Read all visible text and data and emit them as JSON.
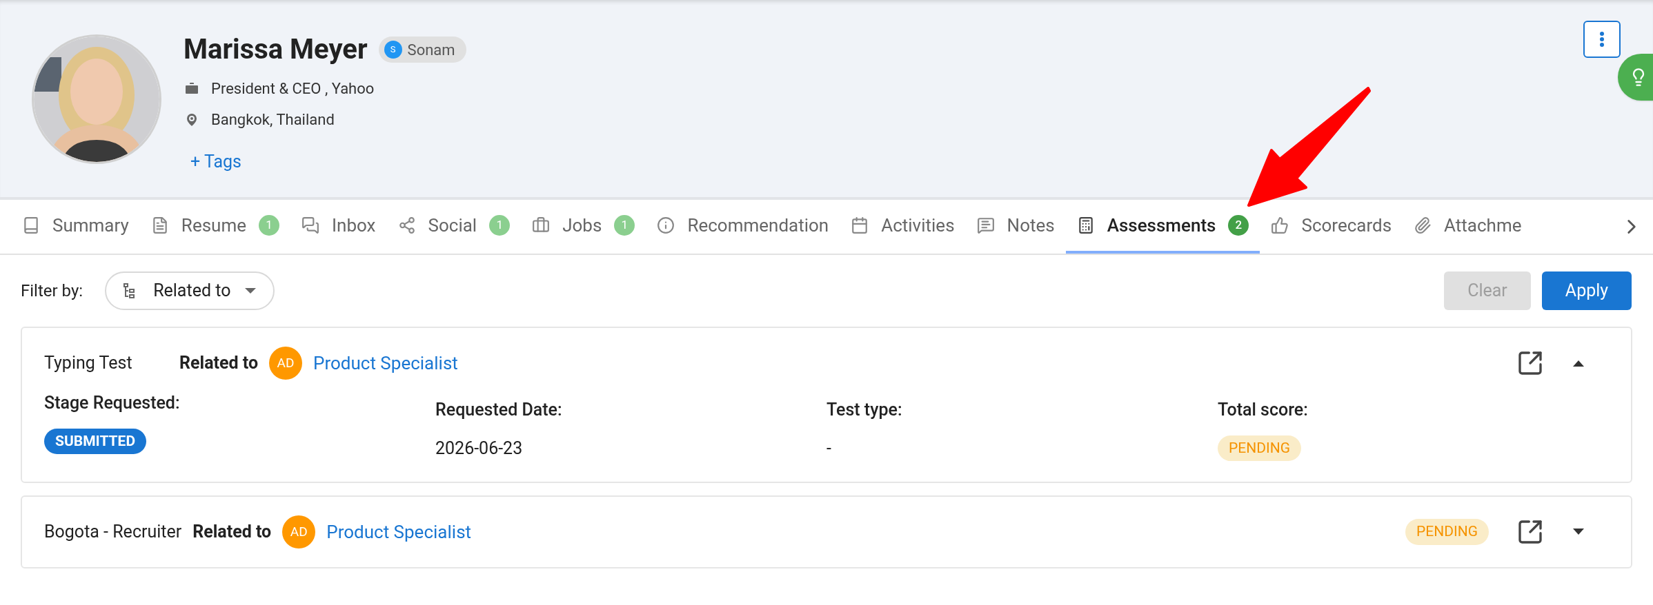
{
  "profile": {
    "name": "Marissa Meyer",
    "owner": {
      "initial": "S",
      "name": "Sonam"
    },
    "job": "President & CEO , Yahoo",
    "location": "Bangkok, Thailand",
    "tags_link": "Tags",
    "tags_plus": "+"
  },
  "tabs": [
    {
      "label": "Summary",
      "selected": false
    },
    {
      "label": "Resume",
      "badge": "1",
      "selected": false
    },
    {
      "label": "Inbox",
      "selected": false
    },
    {
      "label": "Social",
      "badge": "1",
      "selected": false
    },
    {
      "label": "Jobs",
      "badge": "1",
      "selected": false
    },
    {
      "label": "Recommendation",
      "selected": false
    },
    {
      "label": "Activities",
      "selected": false
    },
    {
      "label": "Notes",
      "selected": false
    },
    {
      "label": "Assessments",
      "badge": "2",
      "selected": true
    },
    {
      "label": "Scorecards",
      "selected": false
    },
    {
      "label": "Attachme",
      "selected": false
    }
  ],
  "filter": {
    "label": "Filter by:",
    "value": "Related to",
    "clear": "Clear",
    "apply": "Apply",
    "clear_disabled": true
  },
  "assessments": [
    {
      "title": "Typing Test",
      "related_label": "Related to",
      "avatar": "AD",
      "related": "Product Specialist",
      "expanded": true,
      "fields": [
        {
          "label": "Stage Requested:",
          "chip": {
            "text": "SUBMITTED",
            "kind": "submitted"
          }
        },
        {
          "label": "Requested Date:",
          "value": "2026-06-23"
        },
        {
          "label": "Test type:",
          "value": "-"
        },
        {
          "label": "Total score:",
          "chip": {
            "text": "PENDING",
            "kind": "pending"
          }
        }
      ]
    },
    {
      "title": "Bogota - Recruiter",
      "related_label": "Related to",
      "avatar": "AD",
      "related": "Product Specialist",
      "expanded": false,
      "status": {
        "text": "PENDING",
        "kind": "pending"
      }
    }
  ]
}
